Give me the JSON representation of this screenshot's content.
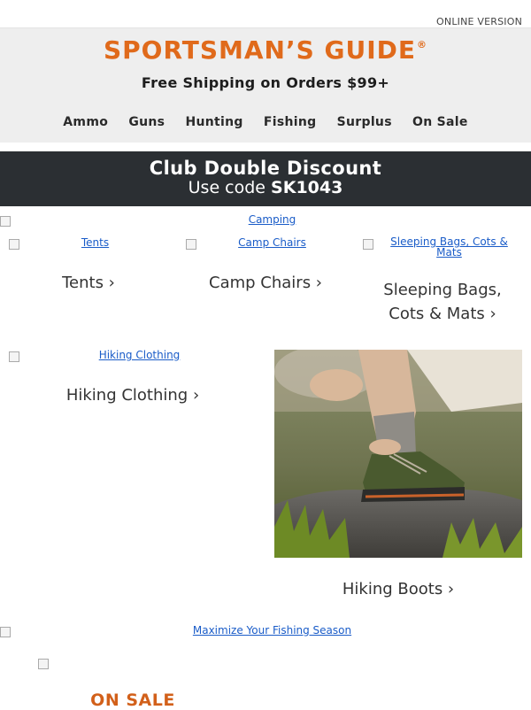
{
  "header": {
    "online_version": "ONLINE VERSION",
    "logo_text": "SPORTSMAN’S GUIDE",
    "logo_mark": "®",
    "shipping": "Free Shipping on Orders $99+",
    "nav": [
      "Ammo",
      "Guns",
      "Hunting",
      "Fishing",
      "Surplus",
      "On Sale"
    ]
  },
  "promo": {
    "title": "Club Double Discount",
    "code_prefix": "Use code",
    "code": "SK1043"
  },
  "banners": {
    "camping_alt": "Camping",
    "fishing_alt": "Maximize Your Fishing Season"
  },
  "categories": {
    "tents_alt": "Tents",
    "tents_label": "Tents ›",
    "chairs_alt": "Camp Chairs",
    "chairs_label": "Camp Chairs ›",
    "sleeping_alt": "Sleeping Bags, Cots & Mats",
    "sleeping_label": "Sleeping Bags, Cots & Mats ›",
    "hiking_clothing_alt": "Hiking Clothing",
    "hiking_clothing_label": "Hiking Clothing ›",
    "hiking_boots_label": "Hiking Boots ›"
  },
  "sale": {
    "label": "ON SALE"
  },
  "colors": {
    "brand_orange": "#e06a1b",
    "promo_bg": "#2b2f33",
    "header_bg": "#eeeeee",
    "link_blue": "#1a5cc8"
  }
}
